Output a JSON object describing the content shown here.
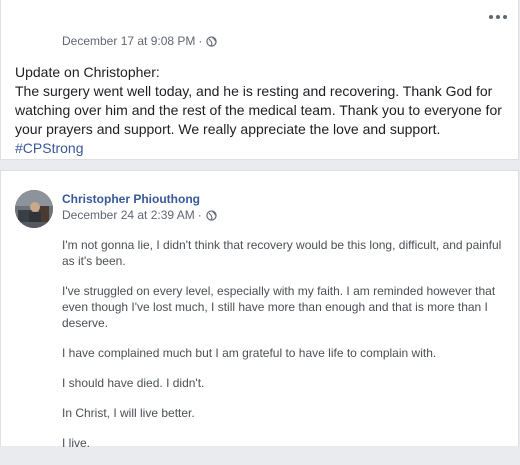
{
  "post1": {
    "timestamp": "December 17 at 9:08 PM",
    "separator": "·",
    "privacy_icon": "globe-icon",
    "more_icon": "more-options-icon",
    "lines": [
      "Update on Christopher:",
      "The surgery went well today, and he is resting and recovering. Thank God for watching over him and the rest of the medical team. Thank you to everyone for your prayers and support. We really appreciate the love and support."
    ],
    "hashtag": "#CPStrong"
  },
  "post2": {
    "author": "Christopher Phiouthong",
    "timestamp": "December 24 at 2:39 AM",
    "separator": "·",
    "privacy_icon": "globe-icon",
    "paragraphs": [
      "I'm not gonna lie, I didn't think that recovery would be this long, difficult, and painful as it's been.",
      "I've struggled on every level, especially with my faith. I am reminded however that even though I've lost much, I still have more than enough and that is more than I deserve.",
      "I have complained much but I am grateful to have life to complain with.",
      "I should have died. I didn't.",
      "In Christ, I will live better.",
      "I live."
    ]
  },
  "colors": {
    "background": "#e9ebee",
    "card": "#ffffff",
    "link": "#385898",
    "meta": "#616770",
    "text": "#1c1e21"
  }
}
